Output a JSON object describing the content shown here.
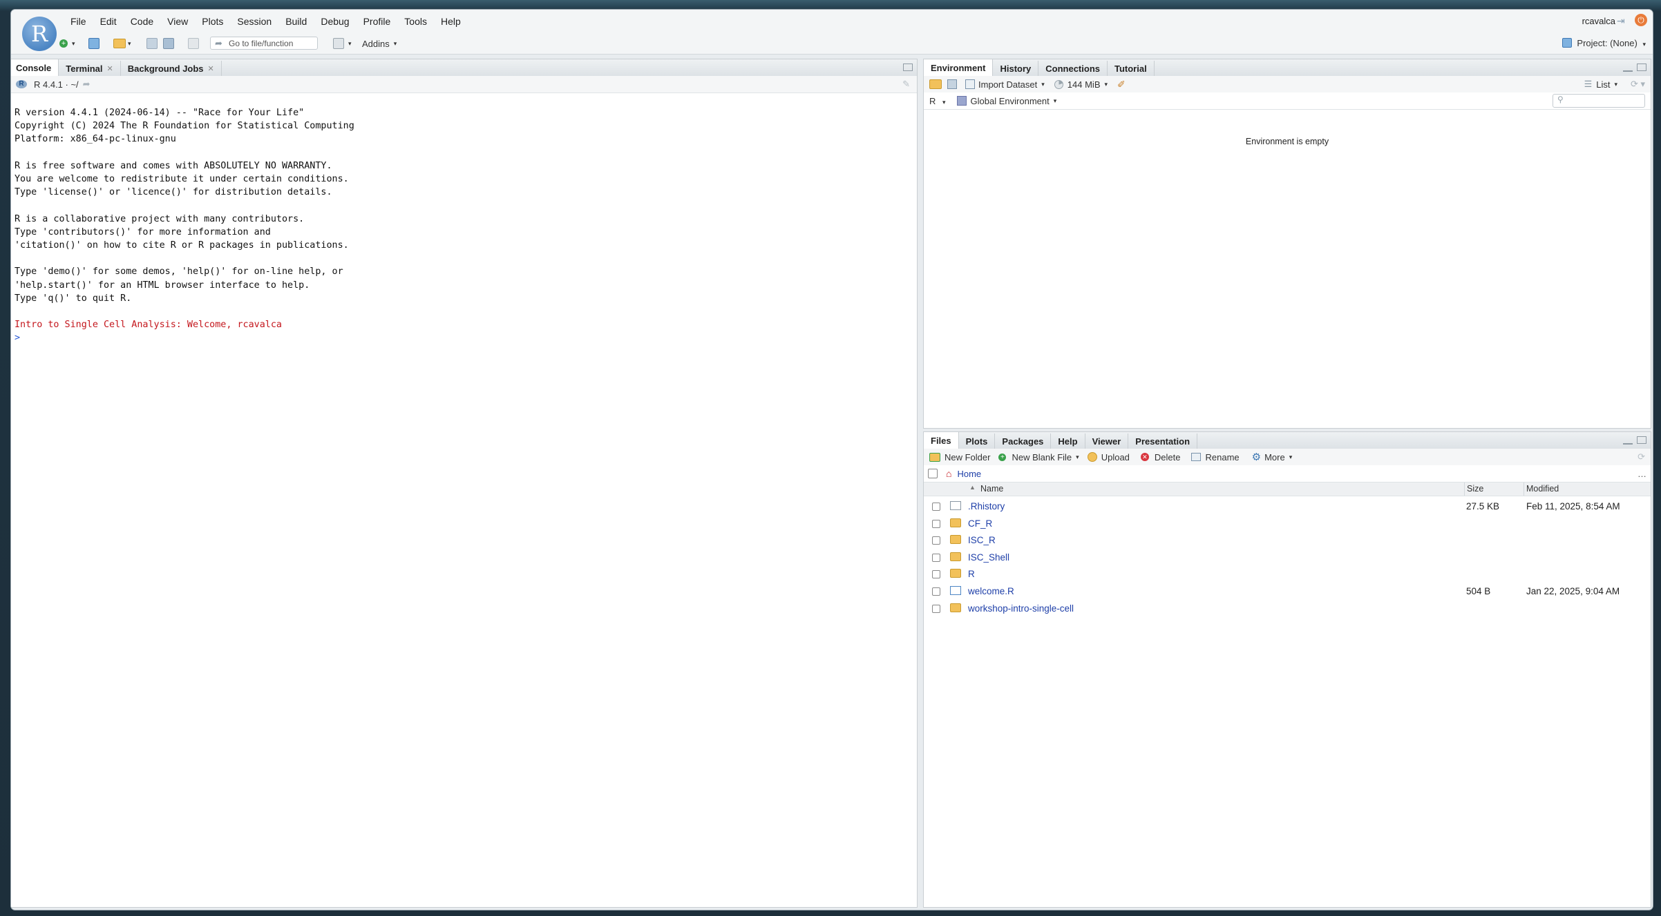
{
  "menubar": {
    "menus": [
      "File",
      "Edit",
      "Code",
      "View",
      "Plots",
      "Session",
      "Build",
      "Debug",
      "Profile",
      "Tools",
      "Help"
    ],
    "user": "rcavalca"
  },
  "toolbar": {
    "goto_placeholder": "Go to file/function",
    "addins": "Addins",
    "project": "Project: (None)"
  },
  "console_pane": {
    "tabs": [
      "Console",
      "Terminal",
      "Background Jobs"
    ],
    "version_path": "R 4.4.1 · ~/",
    "lines": [
      "R version 4.4.1 (2024-06-14) -- \"Race for Your Life\"",
      "Copyright (C) 2024 The R Foundation for Statistical Computing",
      "Platform: x86_64-pc-linux-gnu",
      "",
      "R is free software and comes with ABSOLUTELY NO WARRANTY.",
      "You are welcome to redistribute it under certain conditions.",
      "Type 'license()' or 'licence()' for distribution details.",
      "",
      "R is a collaborative project with many contributors.",
      "Type 'contributors()' for more information and",
      "'citation()' on how to cite R or R packages in publications.",
      "",
      "Type 'demo()' for some demos, 'help()' for on-line help, or",
      "'help.start()' for an HTML browser interface to help.",
      "Type 'q()' to quit R.",
      ""
    ],
    "welcome": "Intro to Single Cell Analysis: Welcome, rcavalca",
    "prompt": ">"
  },
  "env_pane": {
    "tabs": [
      "Environment",
      "History",
      "Connections",
      "Tutorial"
    ],
    "import_dataset": "Import Dataset",
    "memory": "144 MiB",
    "view_mode": "List",
    "language": "R",
    "scope": "Global Environment",
    "empty_message": "Environment is empty"
  },
  "files_pane": {
    "tabs": [
      "Files",
      "Plots",
      "Packages",
      "Help",
      "Viewer",
      "Presentation"
    ],
    "actions": {
      "new_folder": "New Folder",
      "new_blank_file": "New Blank File",
      "upload": "Upload",
      "delete": "Delete",
      "rename": "Rename",
      "more": "More"
    },
    "breadcrumb": "Home",
    "columns": {
      "name": "Name",
      "size": "Size",
      "modified": "Modified"
    },
    "files": [
      {
        "name": ".Rhistory",
        "type": "doc",
        "size": "27.5 KB",
        "modified": "Feb 11, 2025, 8:54 AM"
      },
      {
        "name": "CF_R",
        "type": "folder",
        "size": "",
        "modified": ""
      },
      {
        "name": "ISC_R",
        "type": "folder",
        "size": "",
        "modified": ""
      },
      {
        "name": "ISC_Shell",
        "type": "folder",
        "size": "",
        "modified": ""
      },
      {
        "name": "R",
        "type": "folder",
        "size": "",
        "modified": ""
      },
      {
        "name": "welcome.R",
        "type": "rdoc",
        "size": "504 B",
        "modified": "Jan 22, 2025, 9:04 AM"
      },
      {
        "name": "workshop-intro-single-cell",
        "type": "folder",
        "size": "",
        "modified": ""
      }
    ]
  }
}
